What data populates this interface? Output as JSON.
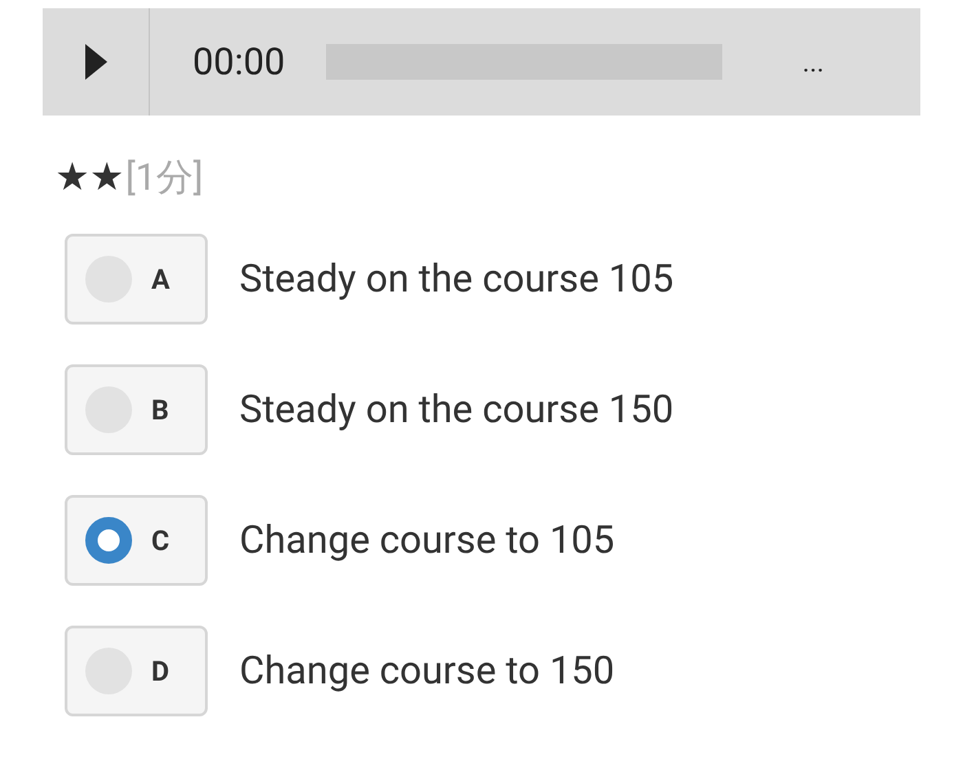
{
  "player": {
    "time": "00:00",
    "more": "..."
  },
  "question": {
    "difficulty": "★★",
    "score": "[1分]"
  },
  "options": [
    {
      "letter": "A",
      "text": "Steady on the course 105",
      "selected": false
    },
    {
      "letter": "B",
      "text": "Steady on the course 150",
      "selected": false
    },
    {
      "letter": "C",
      "text": "Change course to 105",
      "selected": true
    },
    {
      "letter": "D",
      "text": "Change course to 150",
      "selected": false
    }
  ]
}
